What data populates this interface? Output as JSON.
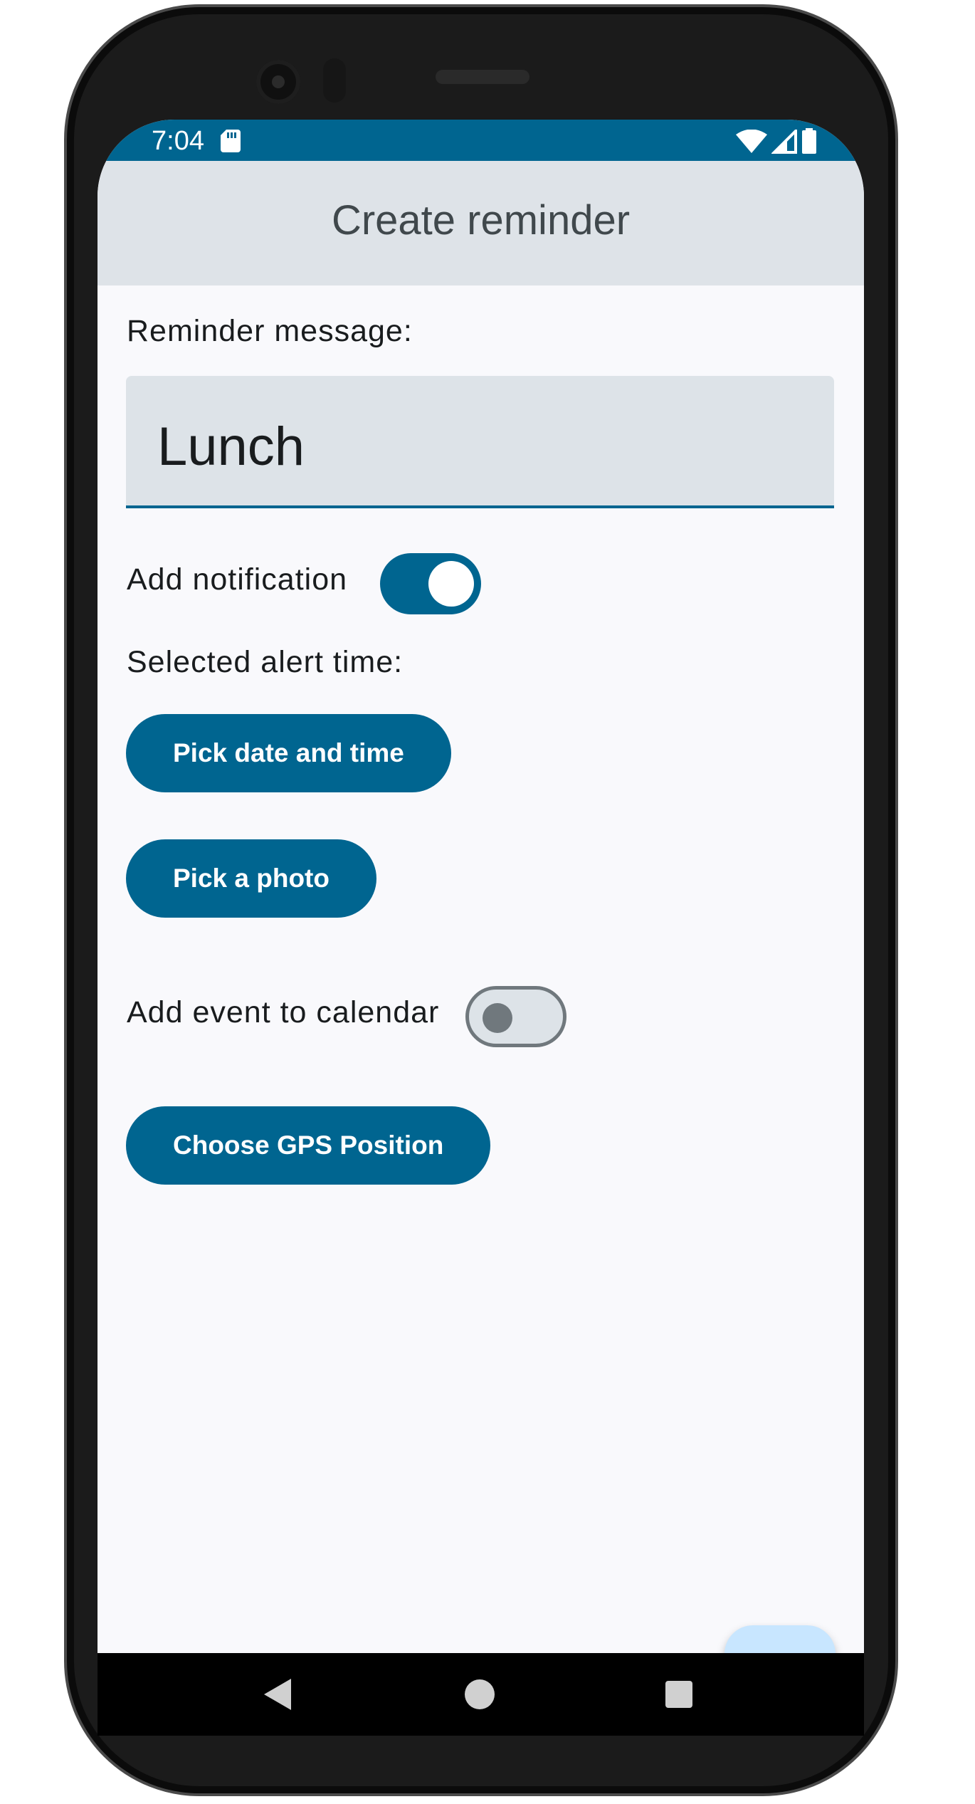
{
  "status_bar": {
    "time": "7:04",
    "icons": [
      "sd-card-icon",
      "wifi-icon",
      "signal-icon",
      "battery-icon"
    ],
    "background": "#006590"
  },
  "app_bar": {
    "title": "Create reminder"
  },
  "form": {
    "message_label": "Reminder message:",
    "message_value": "Lunch",
    "notification_label": "Add notification",
    "notification_enabled": true,
    "alert_time_label": "Selected alert time:",
    "pick_datetime_button": "Pick date and time",
    "pick_photo_button": "Pick a photo",
    "calendar_label": "Add event to calendar",
    "calendar_enabled": false,
    "gps_button": "Choose GPS Position"
  },
  "fab": {
    "icon": "check-icon",
    "background": "#c8e6ff"
  },
  "nav_bar": {
    "icons": [
      "back-icon",
      "home-icon",
      "recents-icon"
    ]
  },
  "colors": {
    "primary": "#006590",
    "surface": "#f9f9fc",
    "app_bar": "#dee3e8",
    "on_surface": "#191c1e"
  }
}
